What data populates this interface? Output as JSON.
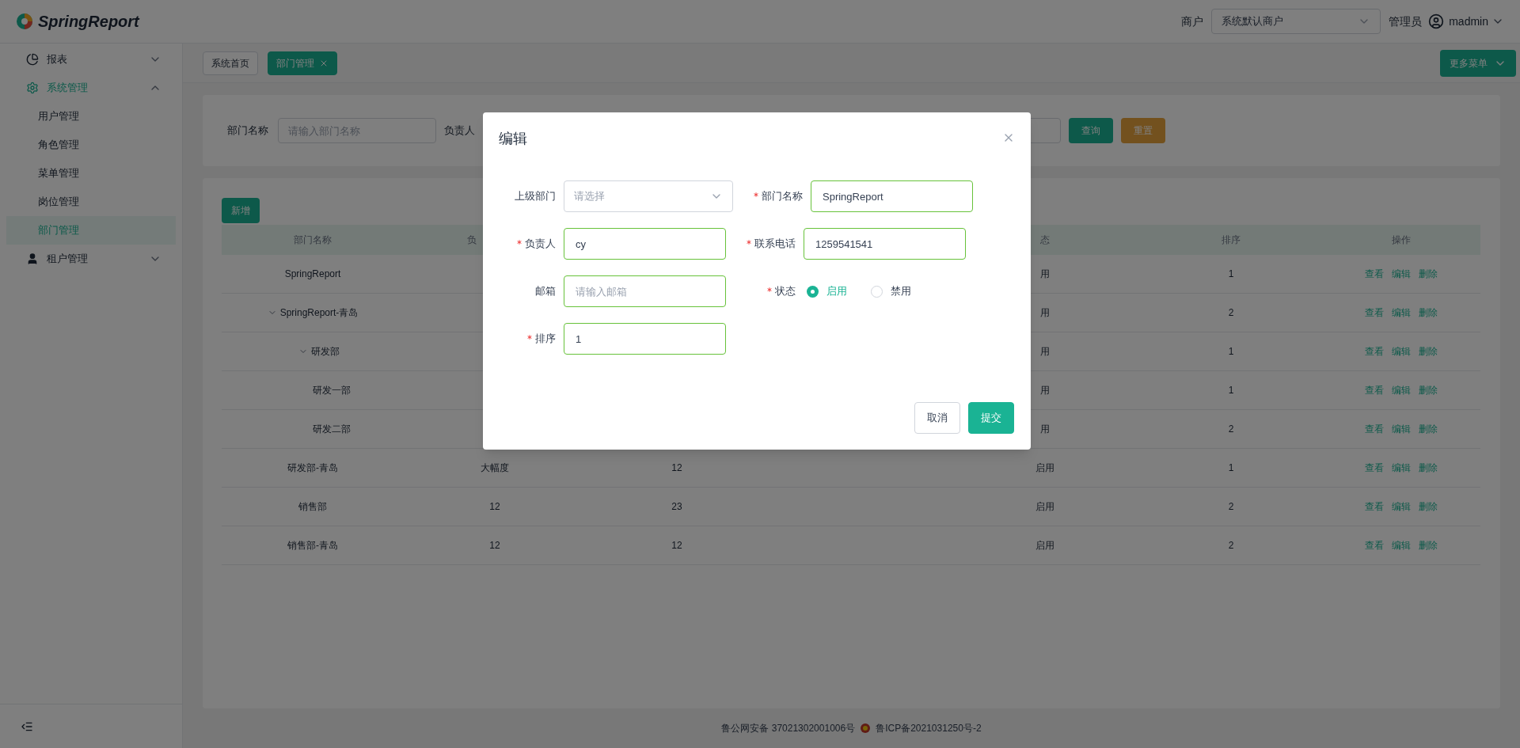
{
  "header": {
    "logo_text": "SpringReport",
    "merchant_label": "商户",
    "merchant_select": "系统默认商户",
    "role": "管理员",
    "user": "madmin"
  },
  "sidebar": {
    "items": [
      {
        "label": "报表",
        "active": false,
        "expanded": false
      },
      {
        "label": "系统管理",
        "active": true,
        "expanded": true,
        "children": [
          {
            "label": "用户管理",
            "selected": false
          },
          {
            "label": "角色管理",
            "selected": false
          },
          {
            "label": "菜单管理",
            "selected": false
          },
          {
            "label": "岗位管理",
            "selected": false
          },
          {
            "label": "部门管理",
            "selected": true
          }
        ]
      },
      {
        "label": "租户管理",
        "active": false,
        "expanded": false
      }
    ]
  },
  "tabs": [
    {
      "label": "系统首页",
      "selected": false,
      "closable": false
    },
    {
      "label": "部门管理",
      "selected": true,
      "closable": true
    }
  ],
  "more_menu": "更多菜单",
  "search": {
    "fields": [
      {
        "label": "部门名称",
        "placeholder": "请输入部门名称"
      },
      {
        "label": "负责人"
      }
    ],
    "buttons": [
      {
        "label": "查询",
        "kind": "primary"
      },
      {
        "label": "重置",
        "kind": "warning"
      }
    ]
  },
  "add_button": "新增",
  "table": {
    "columns": [
      {
        "label": "部门名称"
      },
      {
        "label": "负"
      },
      {},
      {},
      {
        "label": "态"
      },
      {
        "label": "排序"
      },
      {
        "label": "操作"
      }
    ],
    "rows": [
      {
        "name": "SpringReport",
        "status": "用",
        "order": "1",
        "actions": [
          "查看",
          "编辑",
          "删除"
        ]
      },
      {
        "name": "SpringReport-青岛",
        "status": "用",
        "order": "2",
        "actions": [
          "查看",
          "编辑",
          "删除"
        ],
        "expanded": true,
        "children": [
          {
            "name": "研发部",
            "status": "用",
            "order": "1",
            "actions": [
              "查看",
              "编辑",
              "删除"
            ],
            "expanded": true,
            "children": [
              {
                "name": "研发一部",
                "status": "用",
                "order": "1",
                "actions": [
                  "查看",
                  "编辑",
                  "删除"
                ]
              },
              {
                "name": "研发二部",
                "status": "用",
                "order": "2",
                "actions": [
                  "查看",
                  "编辑",
                  "删除"
                ]
              }
            ]
          }
        ]
      },
      {
        "name": "研发部-青岛",
        "leader": "大幅度",
        "phone": "12",
        "status": "启用",
        "order": "1",
        "actions": [
          "查看",
          "编辑",
          "删除"
        ]
      },
      {
        "name": "销售部",
        "leader": "12",
        "phone": "23",
        "status": "启用",
        "order": "2",
        "actions": [
          "查看",
          "编辑",
          "删除"
        ]
      },
      {
        "name": "销售部-青岛",
        "leader": "12",
        "phone": "12",
        "status": "启用",
        "order": "2",
        "actions": [
          "查看",
          "编辑",
          "删除"
        ]
      }
    ]
  },
  "modal": {
    "title": "编辑",
    "rows": [
      [
        {
          "kind": "select",
          "label": "上级部门",
          "required": false,
          "valid": false,
          "placeholder": "请选择"
        },
        {
          "kind": "input",
          "label": "部门名称",
          "required": true,
          "valid": true,
          "value": "SpringReport"
        }
      ],
      [
        {
          "kind": "input",
          "label": "负责人",
          "required": true,
          "valid": true,
          "value": "cy"
        },
        {
          "kind": "input",
          "label": "联系电话",
          "required": true,
          "valid": true,
          "value": "1259541541"
        }
      ],
      [
        {
          "kind": "input",
          "label": "邮箱",
          "required": false,
          "valid": true,
          "placeholder": "请输入邮箱"
        },
        {
          "kind": "radio",
          "label": "状态",
          "required": true,
          "options": [
            {
              "label": "启用",
              "selected": true
            },
            {
              "label": "禁用",
              "selected": false
            }
          ]
        }
      ],
      [
        {
          "kind": "input",
          "label": "排序",
          "required": true,
          "valid": true,
          "value": "1"
        }
      ]
    ],
    "buttons": [
      {
        "label": "取消",
        "kind": "default"
      },
      {
        "label": "提交",
        "kind": "primary"
      }
    ]
  },
  "footer": {
    "police_record": "鲁公网安备 37021302001006号",
    "icp_record": "鲁ICP备2021031250号-2"
  }
}
